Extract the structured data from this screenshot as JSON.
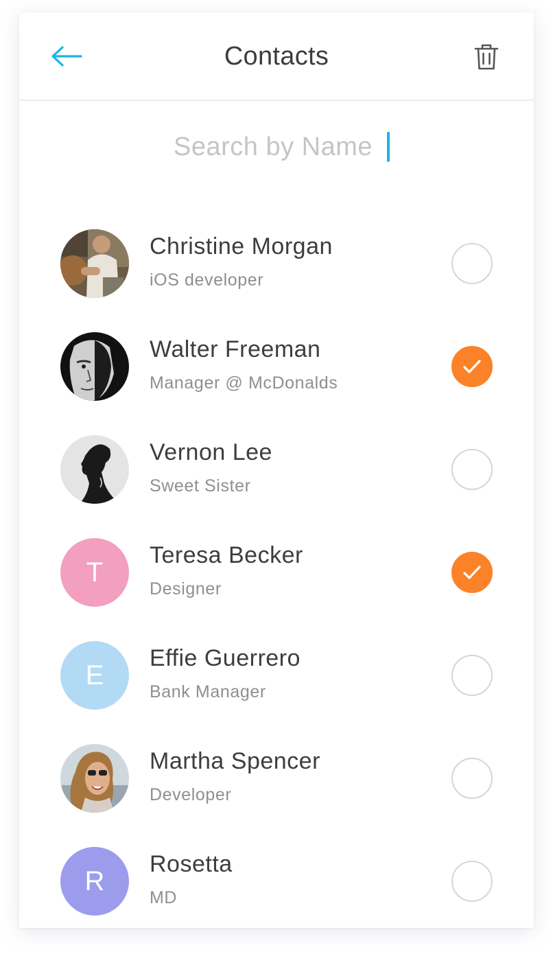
{
  "header": {
    "title": "Contacts",
    "back_icon": "arrow-left-icon",
    "delete_icon": "trash-icon",
    "accent_color": "#19b3e6"
  },
  "search": {
    "placeholder": "Search by Name",
    "value": ""
  },
  "contacts": [
    {
      "name": "Christine Morgan",
      "subtitle": "iOS developer",
      "avatar": "photo",
      "checked": false
    },
    {
      "name": "Walter Freeman",
      "subtitle": "Manager @ McDonalds",
      "avatar": "photo",
      "checked": true
    },
    {
      "name": "Vernon Lee",
      "subtitle": "Sweet Sister",
      "avatar": "photo",
      "checked": false
    },
    {
      "name": "Teresa Becker",
      "subtitle": "Designer",
      "avatar": "initial",
      "initial": "T",
      "avatar_color": "#f29fc0",
      "checked": true
    },
    {
      "name": "Effie Guerrero",
      "subtitle": "Bank Manager",
      "avatar": "initial",
      "initial": "E",
      "avatar_color": "#b3daf5",
      "checked": false
    },
    {
      "name": "Martha Spencer",
      "subtitle": "Developer",
      "avatar": "photo",
      "checked": false
    },
    {
      "name": "Rosetta",
      "subtitle": "MD",
      "avatar": "initial",
      "initial": "R",
      "avatar_color": "#9c9cec",
      "checked": false
    }
  ],
  "check_color": "#fb8228"
}
